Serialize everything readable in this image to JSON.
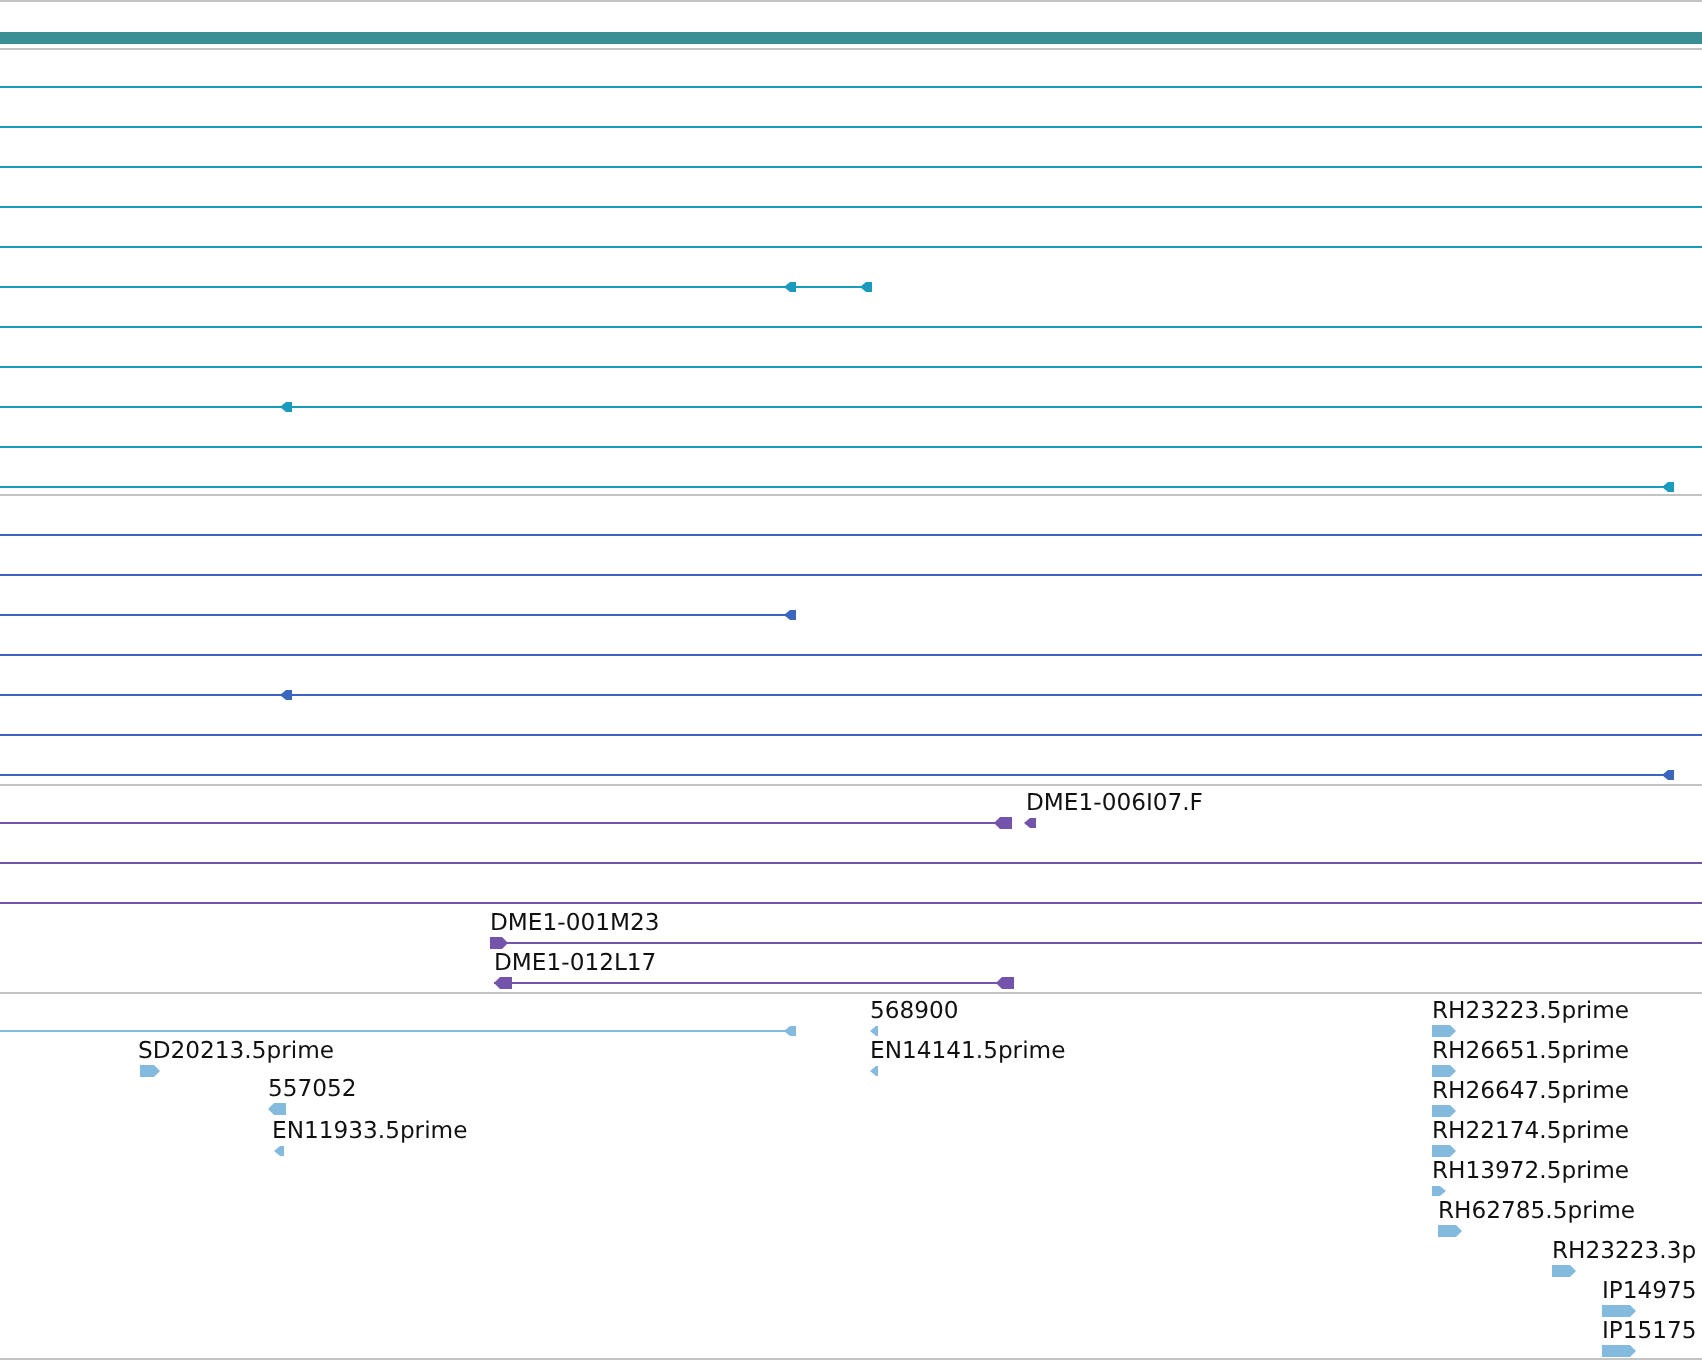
{
  "tracks": [
    {
      "color": "#1a9bbd",
      "features": [
        {
          "kind": "plain"
        },
        {
          "kind": "plain"
        },
        {
          "kind": "plain"
        },
        {
          "kind": "plain"
        },
        {
          "kind": "plain"
        },
        {
          "kind": "reverse"
        },
        {
          "kind": "plain"
        },
        {
          "kind": "plain"
        },
        {
          "kind": "reverse"
        },
        {
          "kind": "plain"
        },
        {
          "kind": "reverse"
        }
      ]
    },
    {
      "color": "#3b66bd",
      "features": [
        {
          "kind": "plain"
        },
        {
          "kind": "plain"
        },
        {
          "kind": "reverse"
        },
        {
          "kind": "plain"
        },
        {
          "kind": "reverse"
        },
        {
          "kind": "plain"
        },
        {
          "kind": "reverse"
        }
      ]
    },
    {
      "color": "#7453ab",
      "features": [
        {
          "kind": "reverse"
        },
        {
          "kind": "reverse",
          "label": "DME1-006I07.F"
        },
        {
          "kind": "plain"
        },
        {
          "kind": "plain"
        },
        {
          "kind": "forward",
          "label": "DME1-001M23"
        },
        {
          "kind": "reverse",
          "label": "DME1-012L17"
        }
      ]
    },
    {
      "color": "#85badf",
      "features": [
        {
          "kind": "reverse"
        },
        {
          "kind": "reverse",
          "label": "568900"
        },
        {
          "kind": "forward",
          "label": "RH23223.5prime"
        },
        {
          "kind": "forward",
          "label": "SD20213.5prime"
        },
        {
          "kind": "reverse",
          "label": "EN14141.5prime"
        },
        {
          "kind": "forward",
          "label": "RH26651.5prime"
        },
        {
          "kind": "reverse",
          "label": "557052"
        },
        {
          "kind": "forward",
          "label": "RH26647.5prime"
        },
        {
          "kind": "reverse",
          "label": "EN11933.5prime"
        },
        {
          "kind": "forward",
          "label": "RH22174.5prime"
        },
        {
          "kind": "forward",
          "label": "RH13972.5prime"
        },
        {
          "kind": "forward",
          "label": "RH62785.5prime"
        },
        {
          "kind": "forward",
          "label": "RH23223.3p"
        },
        {
          "kind": "forward",
          "label": "IP14975"
        },
        {
          "kind": "forward",
          "label": "IP15175"
        }
      ]
    }
  ]
}
